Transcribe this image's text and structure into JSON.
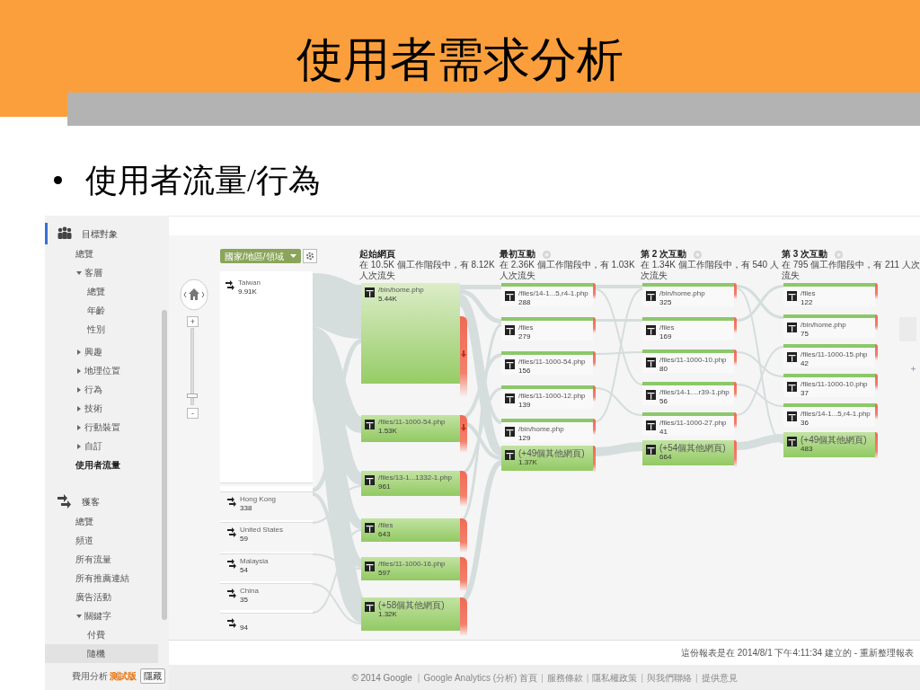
{
  "slide": {
    "title": "使用者需求分析",
    "bullets": [
      "使用者流量/行為"
    ]
  },
  "sidebar": {
    "sections": [
      {
        "label": "目標對象",
        "kind": "audience",
        "active": true,
        "items": [
          {
            "label": "總覽",
            "selected": false,
            "hovered": false
          },
          {
            "label": "客層",
            "selected": false,
            "hovered": false,
            "expanded": true,
            "children": [
              {
                "label": "總覽",
                "selected": false,
                "hovered": false
              },
              {
                "label": "年齡",
                "selected": false,
                "hovered": false
              },
              {
                "label": "性別",
                "selected": false,
                "hovered": false
              }
            ]
          },
          {
            "label": "興趣",
            "selected": false,
            "hovered": false,
            "expanded": false
          },
          {
            "label": "地理位置",
            "selected": false,
            "hovered": false,
            "expanded": false
          },
          {
            "label": "行為",
            "selected": false,
            "hovered": false,
            "expanded": false
          },
          {
            "label": "技術",
            "selected": false,
            "hovered": false,
            "expanded": false
          },
          {
            "label": "行動裝置",
            "selected": false,
            "hovered": false,
            "expanded": false
          },
          {
            "label": "自訂",
            "selected": false,
            "hovered": false,
            "expanded": false
          },
          {
            "label": "使用者流量",
            "selected": true,
            "hovered": false
          }
        ]
      },
      {
        "label": "獲客",
        "kind": "acquisition",
        "active": false,
        "items": [
          {
            "label": "總覽",
            "selected": false,
            "hovered": false
          },
          {
            "label": "頻道",
            "selected": false,
            "hovered": false
          },
          {
            "label": "所有流量",
            "selected": false,
            "hovered": false
          },
          {
            "label": "所有推薦連結",
            "selected": false,
            "hovered": false
          },
          {
            "label": "廣告活動",
            "selected": false,
            "hovered": false
          },
          {
            "label": "關鍵字",
            "selected": false,
            "hovered": false,
            "expanded": true,
            "children": [
              {
                "label": "付費",
                "selected": false,
                "hovered": false
              },
              {
                "label": "隨機",
                "selected": false,
                "hovered": true
              }
            ]
          }
        ]
      }
    ],
    "extra": {
      "label": "費用分析",
      "badge": "測試版",
      "button": "隱藏"
    }
  },
  "flow": {
    "dimension": "國家/地區/領域",
    "zoom": {
      "zoom_in": "+",
      "zoom_out": "-",
      "level": 0.1
    },
    "sources": [
      {
        "name": "Taiwan",
        "value": "9.91K"
      },
      {
        "name": "Hong Kong",
        "value": "338"
      },
      {
        "name": "United States",
        "value": "59"
      },
      {
        "name": "Malaysia",
        "value": "54"
      },
      {
        "name": "China",
        "value": "35"
      },
      {
        "value": "94"
      }
    ],
    "columns": [
      {
        "kind": "start",
        "title": "起始網頁",
        "subtitle": "在 10.5K 個工作階段中，有 8.12K 人次流失",
        "nodes": [
          {
            "kind": "page",
            "name": "/bin/home.php",
            "value": "5.44K"
          },
          {
            "kind": "page",
            "name": "/files/11-1000-54.php",
            "value": "1.53K"
          },
          {
            "kind": "page",
            "name": "/files/13-1...1332-1.php",
            "value": "961"
          },
          {
            "kind": "page",
            "name": "/files",
            "value": "643"
          },
          {
            "kind": "page",
            "name": "/files/11-1000-16.php",
            "value": "597"
          },
          {
            "kind": "group",
            "name": "(+58個其他網頁)",
            "value": "1.32K"
          }
        ]
      },
      {
        "kind": "step",
        "title": "最初互動",
        "subtitle": "在 2.36K 個工作階段中，有 1.03K 人次流失",
        "nodes": [
          {
            "kind": "page",
            "name": "/files/14-1...5,r4-1.php",
            "value": "288"
          },
          {
            "kind": "page",
            "name": "/files",
            "value": "279"
          },
          {
            "kind": "page",
            "name": "/files/11-1000-54.php",
            "value": "156"
          },
          {
            "kind": "page",
            "name": "/files/11-1000-12.php",
            "value": "139"
          },
          {
            "kind": "page",
            "name": "/bin/home.php",
            "value": "129"
          },
          {
            "kind": "group",
            "name": "(+49個其他網頁)",
            "value": "1.37K"
          }
        ]
      },
      {
        "kind": "step",
        "title": "第 2 次互動",
        "subtitle": "在 1.34K 個工作階段中，有 540 人次流失",
        "nodes": [
          {
            "kind": "page",
            "name": "/bin/home.php",
            "value": "325"
          },
          {
            "kind": "page",
            "name": "/files",
            "value": "169"
          },
          {
            "kind": "page",
            "name": "/files/11-1000-10.php",
            "value": "80"
          },
          {
            "kind": "page",
            "name": "/files/14-1....r39-1.php",
            "value": "56"
          },
          {
            "kind": "page",
            "name": "/files/11-1000-27.php",
            "value": "41"
          },
          {
            "kind": "group",
            "name": "(+54個其他網頁)",
            "value": "664"
          }
        ]
      },
      {
        "kind": "step",
        "title": "第 3 次互動",
        "subtitle": "在 795 個工作階段中，有 211 人次流失",
        "nodes": [
          {
            "kind": "page",
            "name": "/files",
            "value": "122"
          },
          {
            "kind": "page",
            "name": "/bin/home.php",
            "value": "75"
          },
          {
            "kind": "page",
            "name": "/files/11-1000-15.php",
            "value": "42"
          },
          {
            "kind": "page",
            "name": "/files/11-1000-10.php",
            "value": "37"
          },
          {
            "kind": "page",
            "name": "/files/14-1...5,r4-1.php",
            "value": "36"
          },
          {
            "kind": "group",
            "name": "(+49個其他網頁)",
            "value": "483"
          }
        ]
      }
    ]
  },
  "note": {
    "text": "這份報表是在 2014/8/1 下午4:11:34 建立的 -",
    "link": "重新整理報表"
  },
  "footer": [
    {
      "kind": "text",
      "text": "© 2014 Google"
    },
    {
      "kind": "separator",
      "text": "|"
    },
    {
      "kind": "link",
      "text": "Google Analytics (分析) 首頁"
    },
    {
      "kind": "separator",
      "text": "|"
    },
    {
      "kind": "link",
      "text": "服務條款"
    },
    {
      "kind": "separator",
      "text": "|"
    },
    {
      "kind": "link",
      "text": "隱私權政策"
    },
    {
      "kind": "separator",
      "text": "|"
    },
    {
      "kind": "link",
      "text": "與我們聯絡"
    },
    {
      "kind": "separator",
      "text": "|"
    },
    {
      "kind": "link",
      "text": "提供意見"
    }
  ]
}
